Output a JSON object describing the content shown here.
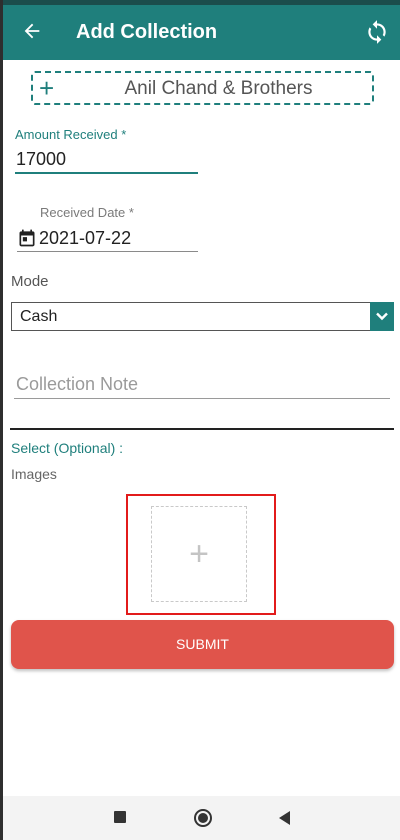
{
  "app_bar": {
    "title": "Add Collection",
    "back_icon": "arrow-left-icon",
    "sync_icon": "sync-icon",
    "color": "#1f7f7c"
  },
  "customer": {
    "plus": "+",
    "name": "Anil Chand & Brothers"
  },
  "amount": {
    "label": "Amount Received *",
    "value": "17000"
  },
  "date": {
    "label": "Received Date *",
    "value": "2021-07-22",
    "icon": "calendar-icon"
  },
  "mode": {
    "label": "Mode",
    "selected": "Cash",
    "caret_icon": "chevron-down-icon"
  },
  "note": {
    "placeholder": "Collection Note"
  },
  "attachments": {
    "select_label": "Select (Optional) :",
    "images_label": "Images",
    "add_symbol": "+"
  },
  "submit": {
    "label": "SUBMIT",
    "color": "#e0544b"
  },
  "nav": {
    "recents_icon": "square-icon",
    "home_icon": "circle-icon",
    "back_icon": "triangle-back-icon"
  },
  "highlight_color": "#e21b1b"
}
